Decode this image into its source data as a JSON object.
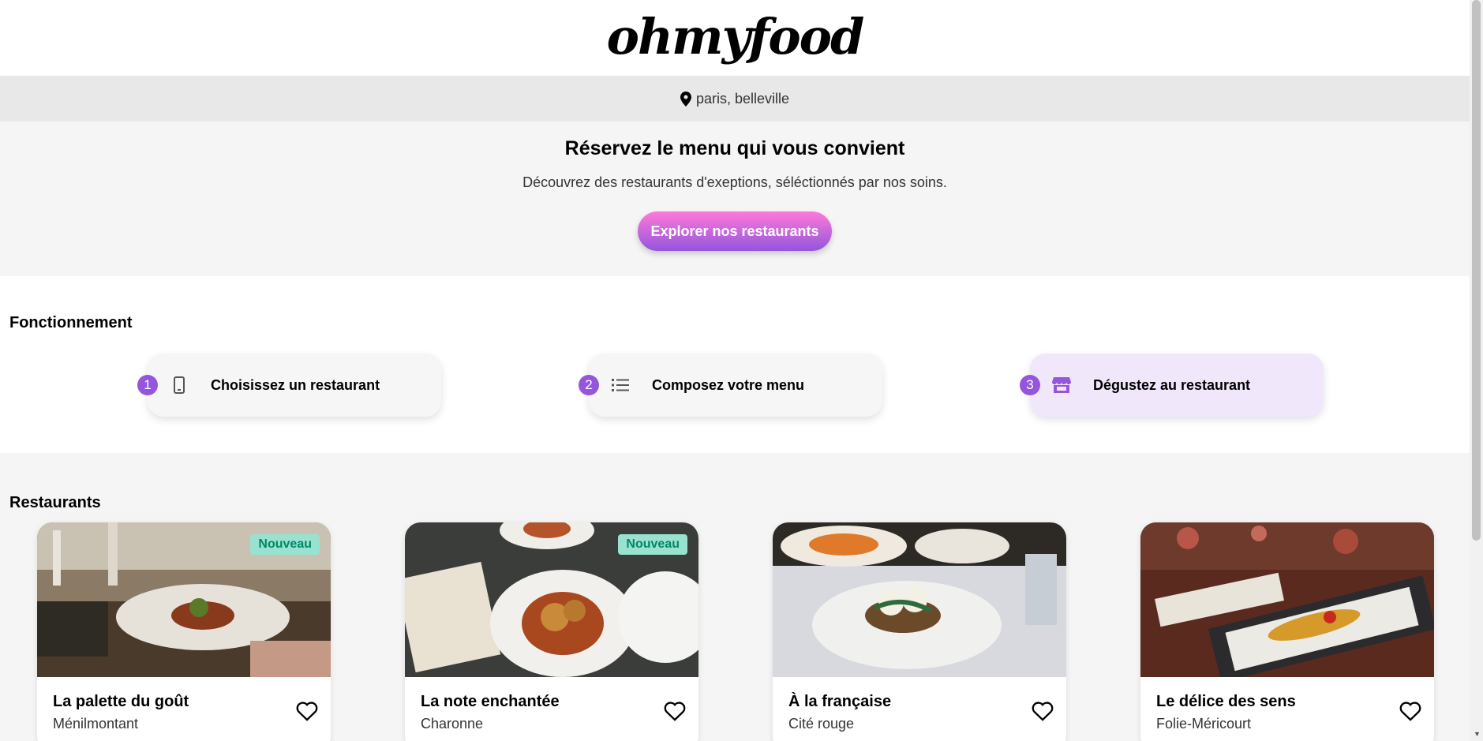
{
  "header": {
    "logo": "ohmyfood"
  },
  "location": {
    "icon": "map-pin-icon",
    "text": "paris, belleville"
  },
  "hero": {
    "title": "Réservez le menu qui vous convient",
    "subtitle": "Découvrez des restaurants d'exeptions, séléctionnés par nos soins.",
    "cta_label": "Explorer nos restaurants"
  },
  "how": {
    "title": "Fonctionnement",
    "steps": [
      {
        "num": "1",
        "icon": "mobile-phone-icon",
        "label": "Choisissez un restaurant"
      },
      {
        "num": "2",
        "icon": "list-icon",
        "label": "Composez votre menu"
      },
      {
        "num": "3",
        "icon": "store-icon",
        "label": "Dégustez au restaurant"
      }
    ]
  },
  "restaurants": {
    "title": "Restaurants",
    "items": [
      {
        "name": "La palette du goût",
        "area": "Ménilmontant",
        "badge": "Nouveau"
      },
      {
        "name": "La note enchantée",
        "area": "Charonne",
        "badge": "Nouveau"
      },
      {
        "name": "À la française",
        "area": "Cité rouge"
      },
      {
        "name": "Le délice des sens",
        "area": "Folie-Méricourt"
      }
    ]
  },
  "colors": {
    "accent": "#9356dc",
    "pink": "#ff79da",
    "badge_bg": "#99e2d0",
    "badge_text": "#008766"
  }
}
